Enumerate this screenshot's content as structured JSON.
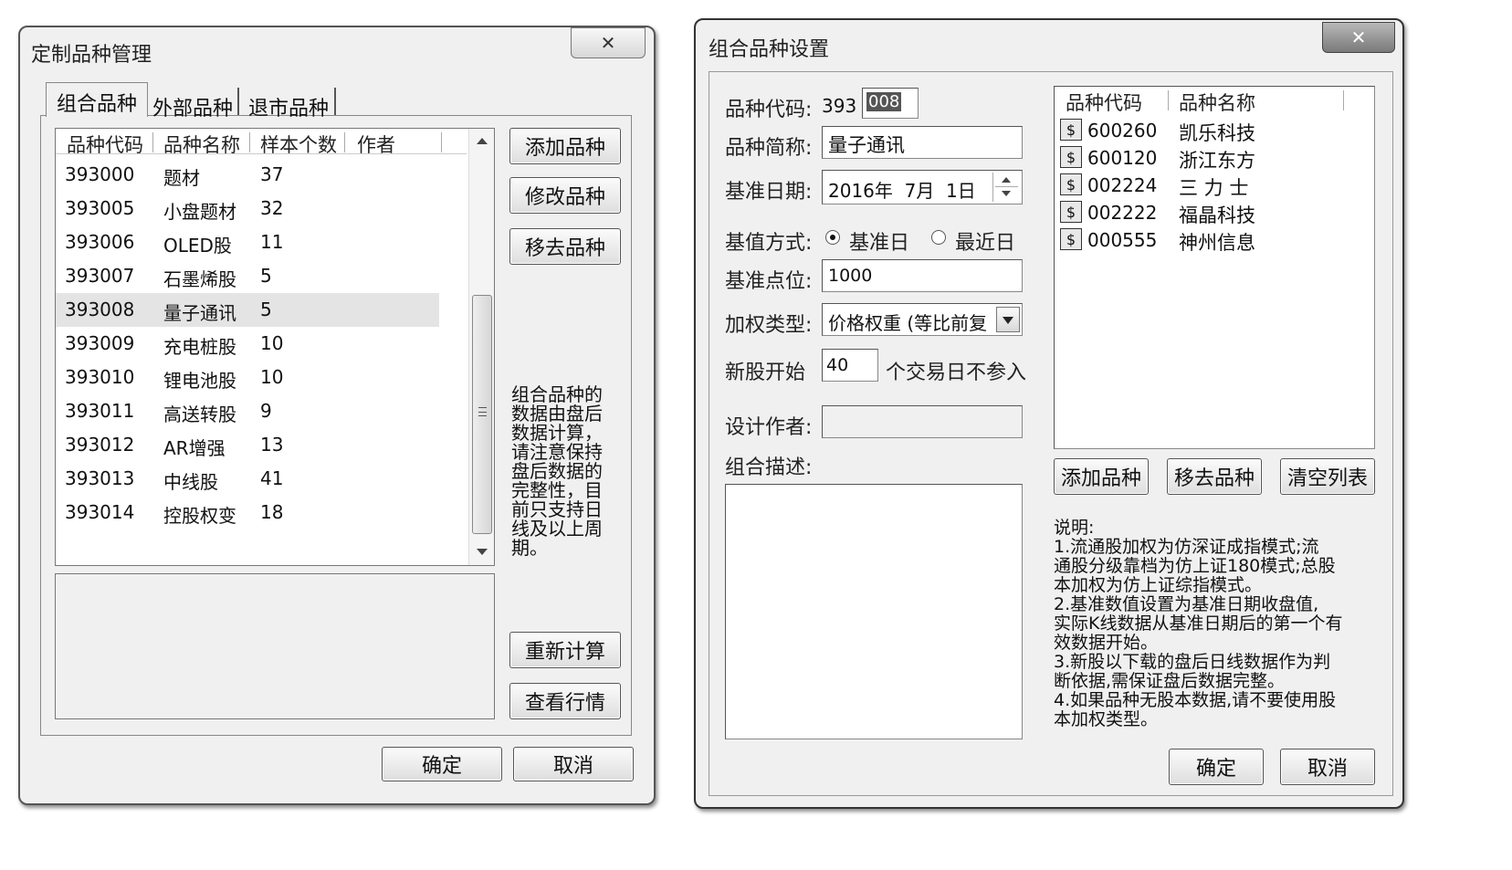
{
  "left_dialog": {
    "title": "定制品种管理",
    "close_glyph": "✕",
    "tabs": [
      "组合品种",
      "外部品种",
      "退市品种"
    ],
    "columns": [
      "品种代码",
      "品种名称",
      "样本个数",
      "作者"
    ],
    "rows": [
      {
        "code": "393000",
        "name": "题材",
        "count": "37"
      },
      {
        "code": "393005",
        "name": "小盘题材",
        "count": "32"
      },
      {
        "code": "393006",
        "name": "OLED股",
        "count": "11"
      },
      {
        "code": "393007",
        "name": "石墨烯股",
        "count": "5"
      },
      {
        "code": "393008",
        "name": "量子通讯",
        "count": "5"
      },
      {
        "code": "393009",
        "name": "充电桩股",
        "count": "10"
      },
      {
        "code": "393010",
        "name": "锂电池股",
        "count": "10"
      },
      {
        "code": "393011",
        "name": "高送转股",
        "count": "9"
      },
      {
        "code": "393012",
        "name": "AR增强",
        "count": "13"
      },
      {
        "code": "393013",
        "name": "中线股",
        "count": "41"
      },
      {
        "code": "393014",
        "name": "控股权变",
        "count": "18"
      }
    ],
    "selected_row": 4,
    "buttons": {
      "add": "添加品种",
      "modify": "修改品种",
      "remove": "移去品种",
      "recalc": "重新计算",
      "view": "查看行情"
    },
    "note_lines": [
      "组合品种的",
      "数据由盘后",
      "数据计算，",
      "请注意保持",
      "盘后数据的",
      "完整性，目",
      "前只支持日",
      "线及以上周",
      "期。"
    ],
    "ok": "确定",
    "cancel": "取消"
  },
  "right_dialog": {
    "title": "组合品种设置",
    "close_glyph": "✕",
    "code_label": "品种代码:",
    "code_prefix": "393",
    "code_value": "008",
    "short_name_label": "品种简称:",
    "short_name_value": "量子通讯",
    "base_date_label": "基准日期:",
    "base_date_value": "2016年  7月  1日",
    "base_method_label": "基值方式:",
    "radio_base_day": "基准日",
    "radio_recent_day": "最近日",
    "radio_selected": "基准日",
    "base_point_label": "基准点位:",
    "base_point_value": "1000",
    "weight_type_label": "加权类型:",
    "weight_type_value": "价格权重 (等比前复",
    "new_stock_label": "新股开始",
    "new_stock_value": "40",
    "new_stock_suffix": "个交易日不参入",
    "author_label": "设计作者:",
    "author_value": "",
    "desc_label": "组合描述:",
    "list_columns": [
      "品种代码",
      "品种名称"
    ],
    "stock_icon": "$",
    "stocks": [
      {
        "code": "600260",
        "name": "凯乐科技"
      },
      {
        "code": "600120",
        "name": "浙江东方"
      },
      {
        "code": "002224",
        "name": "三 力 士"
      },
      {
        "code": "002222",
        "name": "福晶科技"
      },
      {
        "code": "000555",
        "name": "神州信息"
      }
    ],
    "buttons": {
      "add": "添加品种",
      "remove": "移去品种",
      "clear": "清空列表"
    },
    "explain_lines": [
      "说明:",
      "1.流通股加权为仿深证成指模式;流",
      "通股分级靠档为仿上证180模式;总股",
      "本加权为仿上证综指模式。",
      "2.基准数值设置为基准日期收盘值,",
      "实际K线数据从基准日期后的第一个有",
      "效数据开始。",
      "3.新股以下载的盘后日线数据作为判",
      "断依据,需保证盘后数据完整。",
      "4.如果品种无股本数据,请不要使用股",
      "本加权类型。"
    ],
    "ok": "确定",
    "cancel": "取消"
  }
}
